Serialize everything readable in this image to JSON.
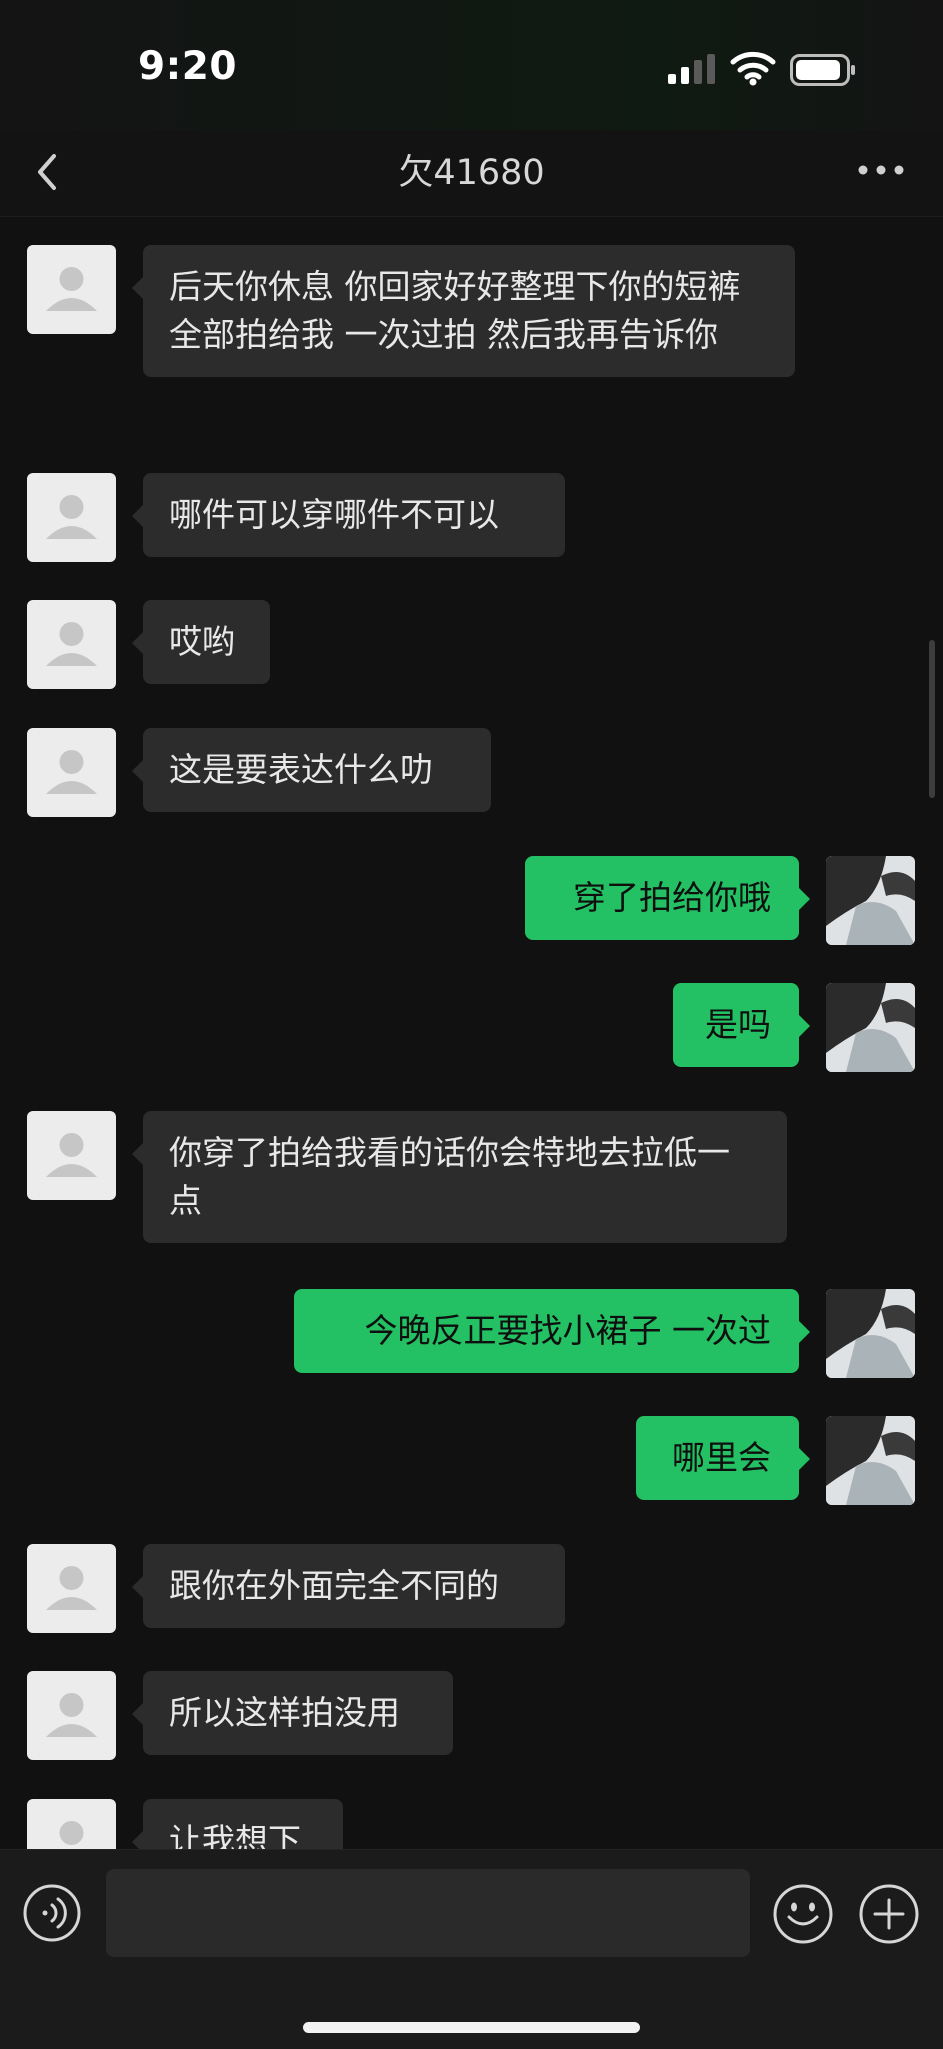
{
  "status_bar": {
    "time": "9:20"
  },
  "header": {
    "title": "欠41680"
  },
  "messages": [
    {
      "side": "in",
      "text": "后天你休息 你回家好好整理下你的短裤 全部拍给我 一次过拍 然后我再告诉你"
    },
    {
      "side": "in",
      "text": "哪件可以穿哪件不可以"
    },
    {
      "side": "in",
      "text": "哎哟"
    },
    {
      "side": "in",
      "text": "这是要表达什么叻"
    },
    {
      "side": "out",
      "text": "穿了拍给你哦"
    },
    {
      "side": "out",
      "text": "是吗"
    },
    {
      "side": "in",
      "text": "你穿了拍给我看的话你会特地去拉低一点"
    },
    {
      "side": "out",
      "text": "今晚反正要找小裙子 一次过"
    },
    {
      "side": "out",
      "text": "哪里会"
    },
    {
      "side": "in",
      "text": "跟你在外面完全不同的"
    },
    {
      "side": "in",
      "text": "所以这样拍没用"
    },
    {
      "side": "in",
      "text": "让我想下"
    }
  ],
  "colors": {
    "outgoing_bubble": "#23c163",
    "incoming_bubble": "#2c2c2c",
    "background": "#111111"
  },
  "icons": {
    "back": "chevron-left-icon",
    "more": "more-dots-icon",
    "voice": "voice-input-icon",
    "emoji": "emoji-icon",
    "plus": "plus-icon"
  }
}
